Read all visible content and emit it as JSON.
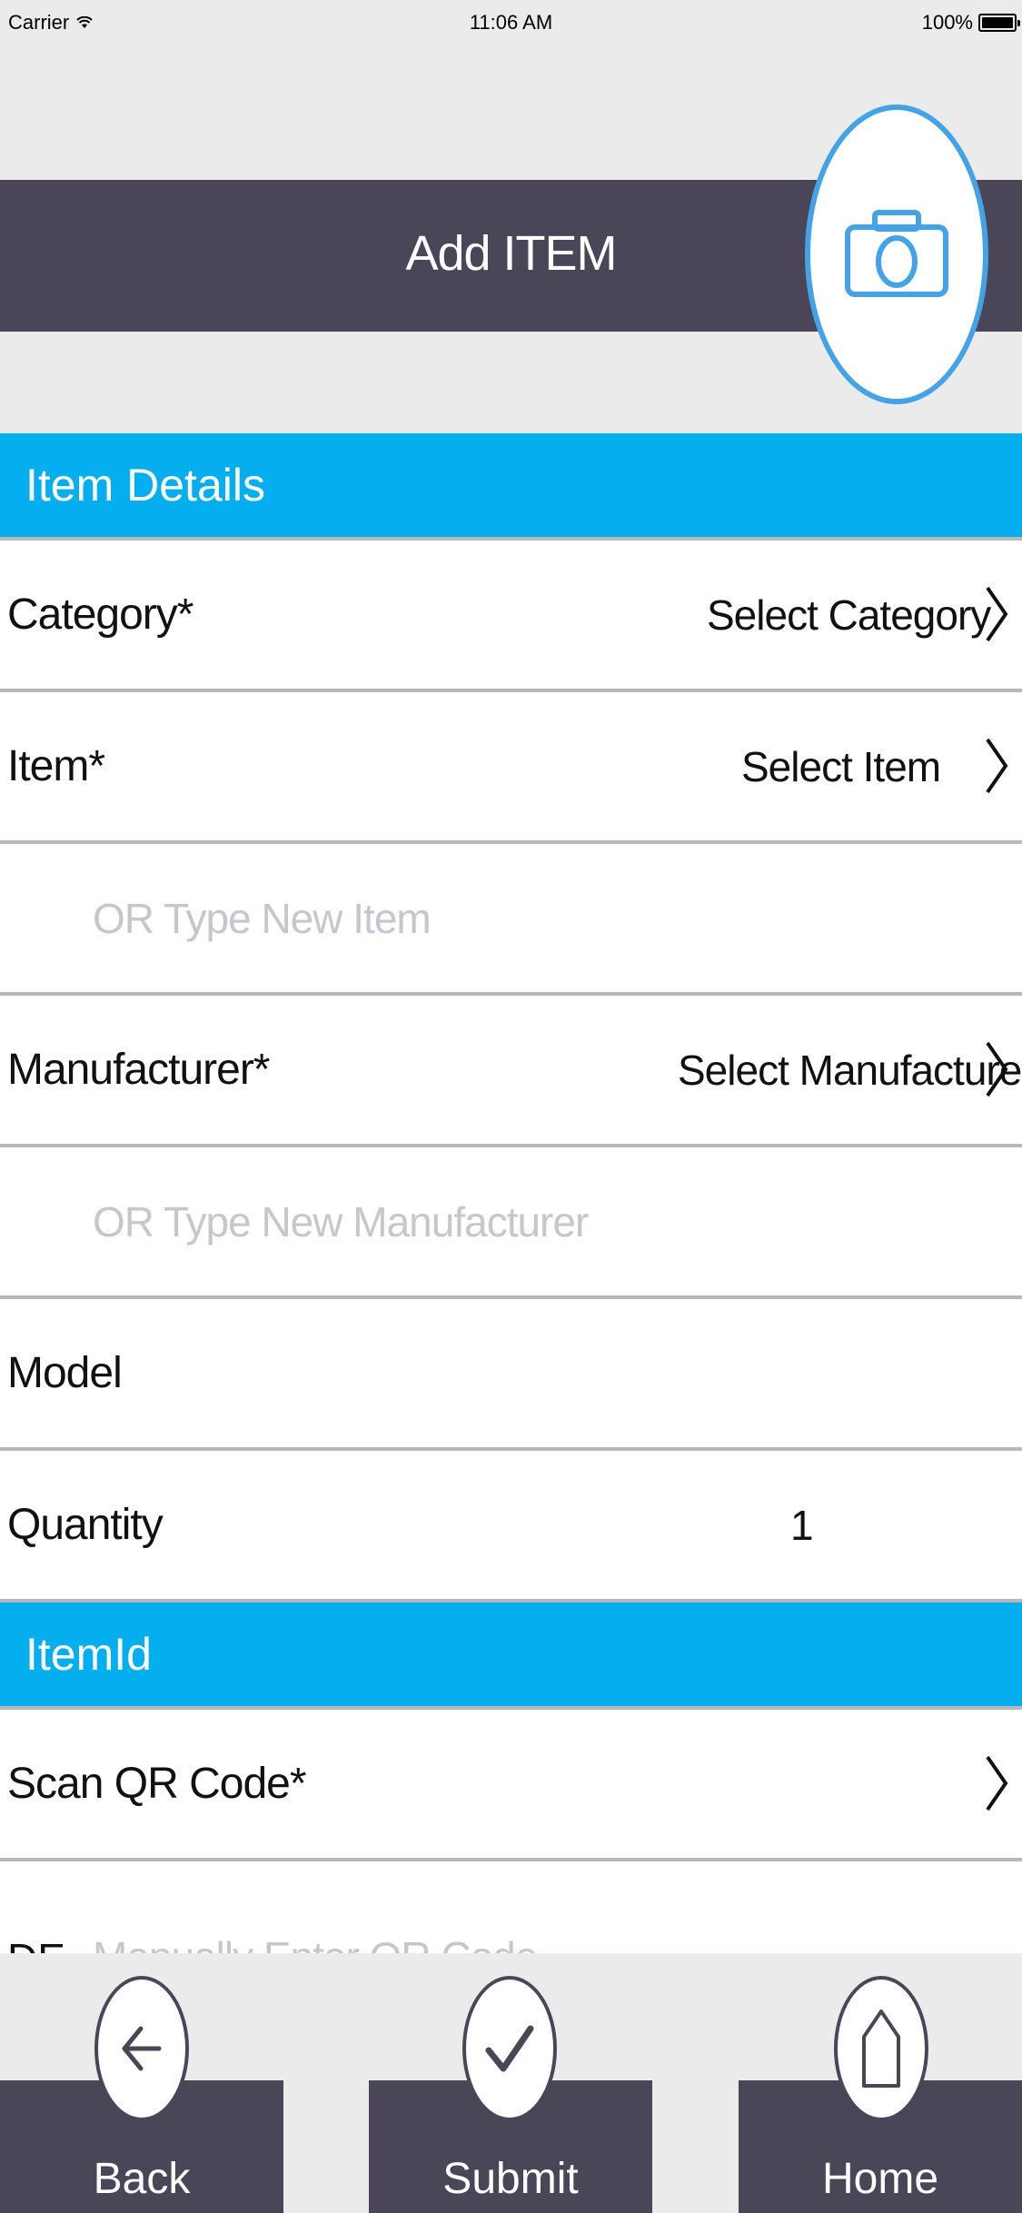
{
  "status_bar": {
    "carrier": "Carrier",
    "time": "11:06 AM",
    "battery": "100%"
  },
  "header": {
    "title": "Add ITEM",
    "camera_icon": "camera-icon"
  },
  "sections": {
    "item_details": "Item Details",
    "item_id": "ItemId"
  },
  "rows": {
    "category": {
      "label": "Category*",
      "value": "Select Category"
    },
    "item": {
      "label": "Item*",
      "value": "Select Item"
    },
    "new_item": {
      "placeholder": "OR Type New Item"
    },
    "manufacturer": {
      "label": "Manufacturer*",
      "value": "Select Manufacturer"
    },
    "new_manufacturer": {
      "placeholder": "OR Type New Manufacturer"
    },
    "model": {
      "label": "Model"
    },
    "quantity": {
      "label": "Quantity",
      "value": "1"
    },
    "scan_qr": {
      "label": "Scan QR Code*"
    },
    "manual_qr": {
      "prefix": "DE",
      "placeholder": "Manually Enter QR Code"
    }
  },
  "bottom_nav": {
    "back": "Back",
    "submit": "Submit",
    "home": "Home"
  },
  "colors": {
    "nav_dark": "#4a4657",
    "section_blue": "#05aeee",
    "camera_blue": "#43a3e6",
    "background": "#ebebeb"
  }
}
